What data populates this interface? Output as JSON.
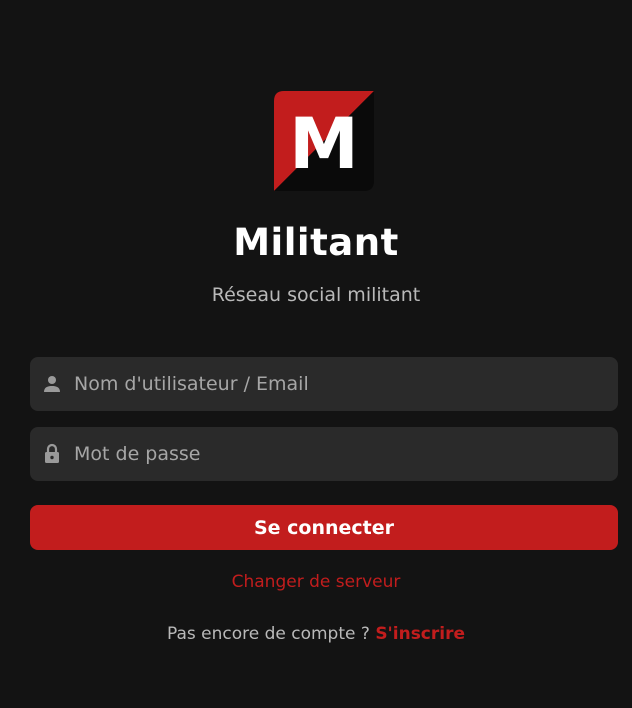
{
  "brand": {
    "logo_letter": "M",
    "title": "Militant",
    "subtitle": "Réseau social militant",
    "accent_color": "#c21d1d",
    "background_color": "#131313"
  },
  "login_form": {
    "username": {
      "icon": "person-icon",
      "placeholder": "Nom d'utilisateur / Email",
      "value": ""
    },
    "password": {
      "icon": "lock-icon",
      "placeholder": "Mot de passe",
      "value": ""
    },
    "submit_label": "Se connecter"
  },
  "links": {
    "change_server": "Changer de serveur",
    "signup_prompt": "Pas encore de compte ?",
    "signup_label": "S'inscrire"
  }
}
